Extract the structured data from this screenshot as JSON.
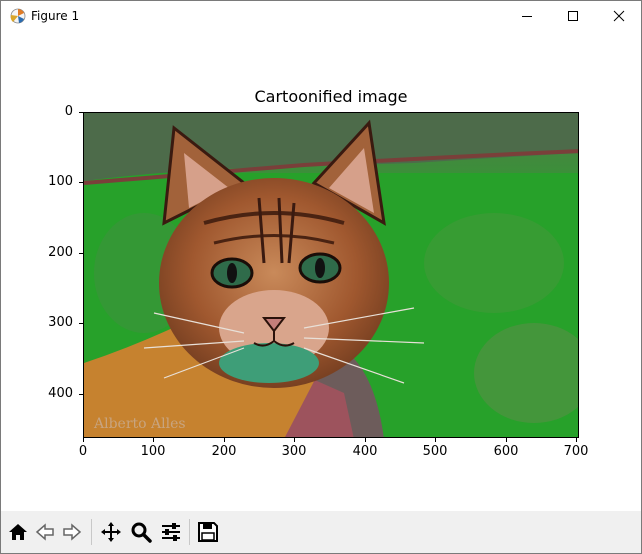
{
  "window": {
    "title": "Figure 1"
  },
  "figure": {
    "title": "Cartoonified image",
    "x_ticks": [
      "0",
      "100",
      "200",
      "300",
      "400",
      "500",
      "600",
      "700"
    ],
    "y_ticks": [
      "0",
      "100",
      "200",
      "300",
      "400"
    ],
    "watermark": "Alberto Alles"
  },
  "toolbar": {
    "buttons": [
      "home-icon",
      "back-arrow-icon",
      "forward-arrow-icon",
      "pan-icon",
      "zoom-icon",
      "configure-subplots-icon",
      "save-icon"
    ]
  }
}
